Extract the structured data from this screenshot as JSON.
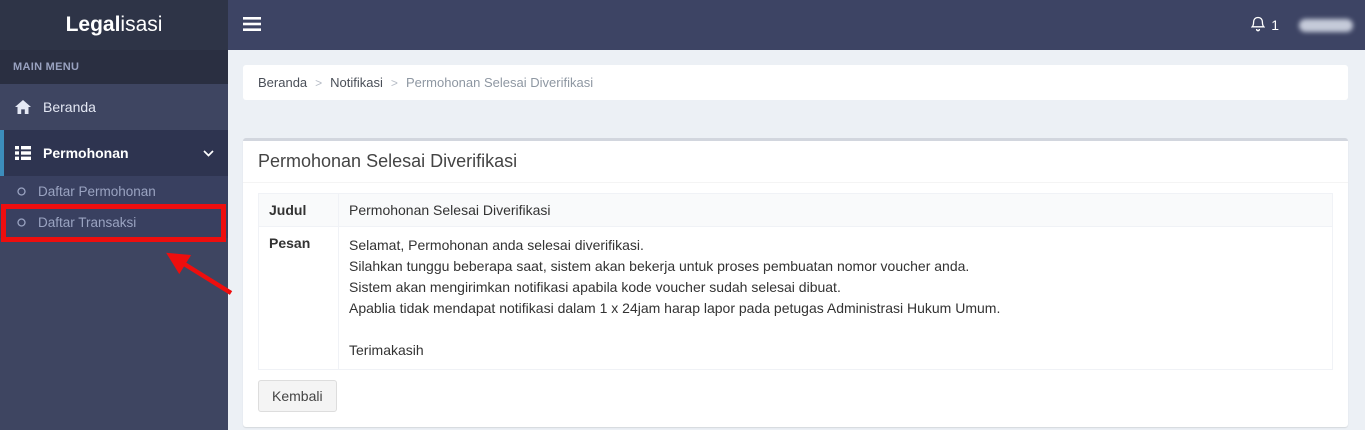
{
  "brand": {
    "bold": "Legal",
    "light": "isasi"
  },
  "navbar": {
    "notification_count": "1"
  },
  "sidebar": {
    "section_label": "MAIN MENU",
    "items": [
      {
        "label": "Beranda",
        "icon": "home-icon",
        "active": false
      },
      {
        "label": "Permohonan",
        "icon": "list-icon",
        "active": true,
        "expanded": true,
        "children": [
          {
            "label": "Daftar Permohonan"
          },
          {
            "label": "Daftar Transaksi",
            "annotated": true
          }
        ]
      }
    ]
  },
  "breadcrumb": {
    "separator": ">",
    "items": [
      "Beranda",
      "Notifikasi",
      "Permohonan Selesai Diverifikasi"
    ]
  },
  "page": {
    "title": "Permohonan Selesai Diverifikasi",
    "table": {
      "rows": [
        {
          "label": "Judul",
          "value": "Permohonan Selesai Diverifikasi"
        },
        {
          "label": "Pesan",
          "lines": [
            "Selamat, Permohonan anda selesai diverifikasi.",
            "Silahkan tunggu beberapa saat, sistem akan bekerja untuk proses pembuatan nomor voucher anda.",
            "Sistem akan mengirimkan notifikasi apabila kode voucher sudah selesai dibuat.",
            "Apablia tidak mendapat notifikasi dalam 1 x 24jam harap lapor pada petugas Administrasi Hukum Umum.",
            "",
            "Terimakasih"
          ]
        }
      ]
    },
    "back_button": "Kembali"
  },
  "colors": {
    "sidebar_bg": "#3e4561",
    "logo_bg": "#2e3447",
    "navbar_bg": "#3d4464",
    "menu_header_bg": "#2a2f41",
    "active_item_bg": "#2e3450",
    "active_item_border": "#3c8dbc",
    "content_bg": "#ecf0f5",
    "card_top_border": "#d2d6de",
    "annotation_red": "#ee0e0e"
  }
}
